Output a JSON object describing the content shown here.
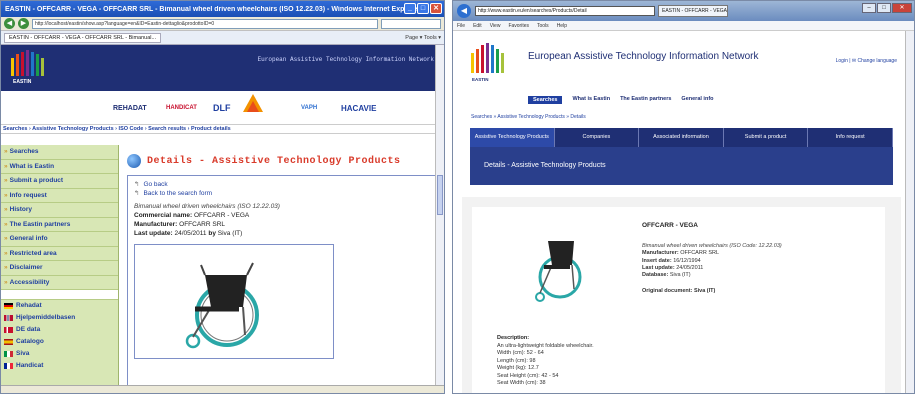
{
  "left": {
    "window_title": "EASTIN - OFFCARR - VEGA - OFFCARR SRL - Bimanual wheel driven wheelchairs (ISO 12.22.03) - Windows Internet Explorer",
    "window_buttons": {
      "minimize": "_",
      "maximize": "□",
      "close": "✕"
    },
    "url": "http://localhost/eastin/show.asp?language=en&ID=Eastin-dettaglio&prodottoID=0",
    "tab_title": "EASTIN - OFFCARR - VEGA - OFFCARR SRL - Bimanual...",
    "tools": "Page ▾  Tools ▾",
    "banner_title": "European Assistive Technology Information Network",
    "logo_text": "EASTIN",
    "partners": [
      "REHADAT",
      "HANDICAT",
      "DLF",
      "VAPH",
      "HACAVIE"
    ],
    "breadcrumb": "Searches › Assistive Technology Products › ISO Code › Search results › Product details",
    "sidebar": [
      "Searches",
      "What is Eastin",
      "Submit a product",
      "Info request",
      "History",
      "The Eastin partners",
      "General info",
      "Restricted area",
      "Disclaimer",
      "Accessibility"
    ],
    "sidebar_links": [
      {
        "label": "Rehadat",
        "flag": [
          "#000000",
          "#dd0000",
          "#ffce00"
        ]
      },
      {
        "label": "Hjelpemiddelbasen",
        "flag": [
          "#ba0c2f",
          "#ffffff",
          "#00205b"
        ]
      },
      {
        "label": "DE data",
        "flag": [
          "#c8102e",
          "#ffffff",
          "#c8102e"
        ]
      },
      {
        "label": "Catalogo",
        "flag": [
          "#aa151b",
          "#f1bf00",
          "#aa151b"
        ]
      },
      {
        "label": "Siva",
        "flag": [
          "#009246",
          "#ffffff",
          "#ce2b37"
        ]
      },
      {
        "label": "Handicat",
        "flag": [
          "#002395",
          "#ffffff",
          "#ed2939"
        ]
      }
    ],
    "page_heading": "Details - Assistive Technology Products",
    "links": [
      "Go back",
      "Back to the search form"
    ],
    "description": "Bimanual wheel driven wheelchairs (ISO 12.22.03)",
    "fields": [
      {
        "label": "Commercial name:",
        "value": "OFFCARR - VEGA"
      },
      {
        "label": "Manufacturer:",
        "value": "OFFCARR SRL"
      },
      {
        "label": "Last update:",
        "value": "24/05/2011",
        "by_label": "by",
        "by": "Siva (IT)"
      }
    ]
  },
  "right": {
    "url": "http://www.eastin.eu/en/searches/Products/Detail",
    "tab_title": "EASTIN - OFFCARR - VEGA",
    "menu": [
      "File",
      "Edit",
      "View",
      "Favorites",
      "Tools",
      "Help"
    ],
    "logo_text": "EASTIN",
    "site_title": "European Assistive Technology Information Network",
    "lang": "Login  |  ✉ Change language",
    "top_nav": [
      "Searches",
      "What is Eastin",
      "The Eastin partners",
      "General info"
    ],
    "breadcrumb": "Searches » Assistive Technology Products » Details",
    "tabs": [
      "Assistive Technology Products",
      "Companies",
      "Associated information",
      "Submit a product",
      "Info request"
    ],
    "panel_title": "Details - Assistive Technology Products",
    "product_name": "OFFCARR - VEGA",
    "iso_line": "Bimanual wheel driven wheelchairs (ISO Code: 12.22.03)",
    "fields": [
      {
        "label": "Manufacturer:",
        "value": "OFFCARR SRL"
      },
      {
        "label": "Insert date:",
        "value": "16/12/1994"
      },
      {
        "label": "Last update:",
        "value": "24/05/2011"
      },
      {
        "label": "Database:",
        "value": "Siva (IT)"
      }
    ],
    "original_doc": "Original document: Siva (IT)",
    "description_heading": "Description:",
    "description_lines": [
      "An ultra-lightweight foldable wheelchair.",
      "Width (cm): 52 - 64",
      "Length (cm): 98",
      "Weight (kg): 12.7",
      "Seat Height (cm): 42 - 54",
      "Seat Width (cm): 38"
    ]
  }
}
